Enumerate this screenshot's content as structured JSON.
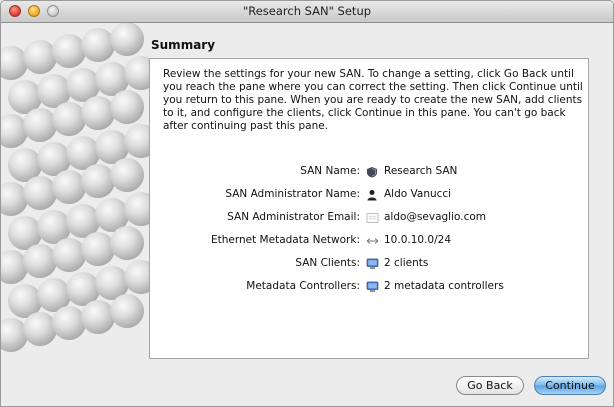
{
  "window": {
    "title": "\"Research SAN\" Setup"
  },
  "pane": {
    "heading": "Summary",
    "description": "Review the settings for your new SAN. To change a setting, click Go Back until you reach the pane where you can correct the setting. Then click Continue until you return to this pane. When you are ready to create the new SAN, add clients to it, and configure the clients, click Continue in this pane. You can't go back after continuing past this pane."
  },
  "summary": [
    {
      "label": "SAN Name:",
      "icon": "san-icon",
      "value": "Research SAN"
    },
    {
      "label": "SAN Administrator Name:",
      "icon": "person-icon",
      "value": "Aldo Vanucci"
    },
    {
      "label": "SAN Administrator Email:",
      "icon": "email-icon",
      "value": "aldo@sevaglio.com"
    },
    {
      "label": "Ethernet Metadata Network:",
      "icon": "network-arrows-icon",
      "value": "10.0.10.0/24"
    },
    {
      "label": "SAN Clients:",
      "icon": "computer-icon",
      "value": "2 clients"
    },
    {
      "label": "Metadata Controllers:",
      "icon": "computer-icon",
      "value": "2 metadata controllers"
    }
  ],
  "buttons": {
    "back": "Go Back",
    "continue": "Continue"
  },
  "colors": {
    "default_button": "#5aa3e2",
    "panel_background": "#ffffff",
    "window_background": "#ececec"
  }
}
